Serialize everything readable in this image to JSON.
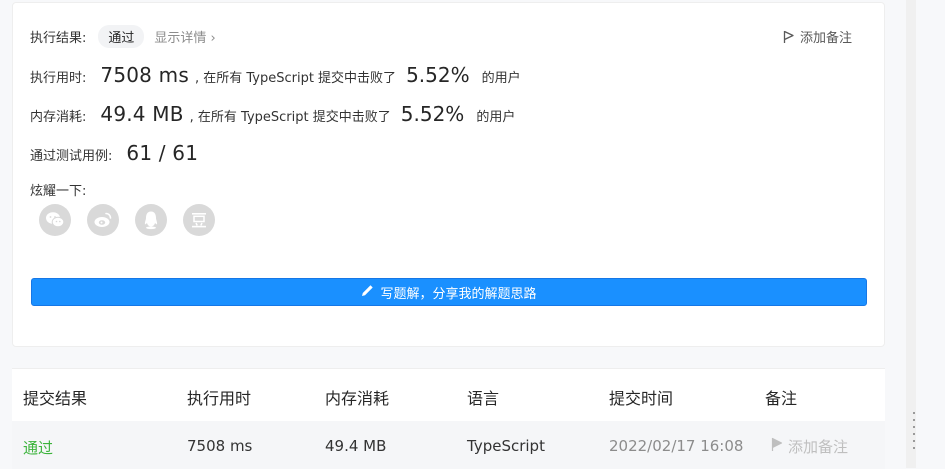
{
  "result": {
    "label": "执行结果:",
    "status": "通过",
    "detail_link": "显示详情 ›",
    "add_note": "添加备注"
  },
  "runtime": {
    "label": "执行用时:",
    "value": "7508 ms",
    "middle": ", 在所有 TypeScript 提交中击败了",
    "percent": "5.52%",
    "suffix": "的用户"
  },
  "memory": {
    "label": "内存消耗:",
    "value": "49.4 MB",
    "middle": ", 在所有 TypeScript 提交中击败了",
    "percent": "5.52%",
    "suffix": "的用户"
  },
  "tests": {
    "label": "通过测试用例:",
    "value": "61 / 61"
  },
  "share": {
    "label": "炫耀一下:",
    "icons": [
      "wechat-icon",
      "weibo-icon",
      "qq-icon",
      "douban-icon"
    ]
  },
  "solution_button": "写题解，分享我的解题思路",
  "table": {
    "headers": [
      "提交结果",
      "执行用时",
      "内存消耗",
      "语言",
      "提交时间",
      "备注"
    ],
    "rows": [
      {
        "result": "通过",
        "runtime": "7508 ms",
        "memory": "49.4 MB",
        "language": "TypeScript",
        "time": "2022/02/17 16:08",
        "note": "添加备注"
      }
    ]
  },
  "colors": {
    "accent": "#1a90ff",
    "pass": "#3bb33b",
    "icon_bg": "#d9d9d9"
  }
}
